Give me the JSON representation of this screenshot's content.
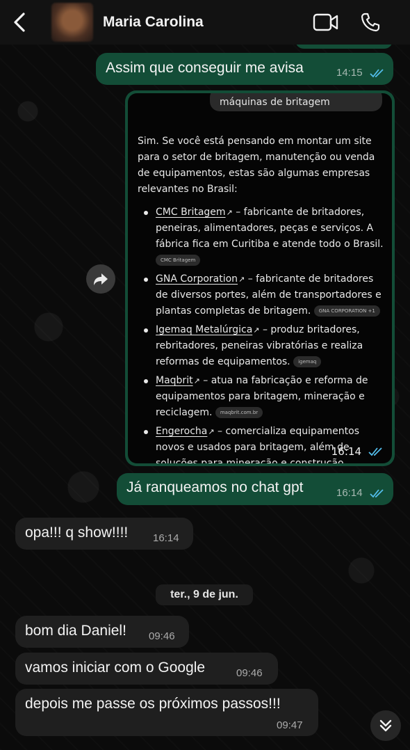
{
  "header": {
    "contact_name": "Maria Carolina",
    "icons": [
      "back-chevron-icon",
      "video-call-icon",
      "phone-call-icon"
    ]
  },
  "messages": [
    {
      "dir": "out",
      "text": "Assim que conseguir me avisa",
      "time": "14:15",
      "status": "read"
    },
    {
      "dir": "out",
      "type": "image",
      "time": "16:14",
      "status": "read"
    },
    {
      "dir": "out",
      "text": "Já ranqueamos no chat gpt",
      "time": "16:14",
      "status": "read"
    },
    {
      "dir": "in",
      "text": "opa!!! q show!!!!",
      "time": "16:14"
    },
    {
      "dir": "in",
      "text": "bom dia Daniel!",
      "time": "09:46"
    },
    {
      "dir": "in",
      "text": "vamos iniciar com o Google",
      "time": "09:46"
    },
    {
      "dir": "in",
      "text": "depois me passe os próximos passos!!!",
      "time": "09:47"
    }
  ],
  "date_divider": "ter., 9 de jun.",
  "screenshot": {
    "query": "máquinas de britagem",
    "intro": "Sim. Se você está pensando em montar um site para o setor de britagem, manutenção ou venda de equipamentos, estas são algumas empresas relevantes no Brasil:",
    "items": [
      {
        "name": "CMC Britagem",
        "desc": " – fabricante de britadores, peneiras, alimentadores, peças e serviços. A fábrica fica em Curitiba e atende todo o Brasil.",
        "source": "CMC Britagem"
      },
      {
        "name": "GNA Corporation",
        "desc": " – fabricante de britadores de diversos portes, além de transportadores e plantas completas de britagem.",
        "source": "GNA CORPORATION +1"
      },
      {
        "name": "Igemaq Metalúrgica",
        "desc": " – produz britadores, rebritadores, peneiras vibratórias e realiza reformas de equipamentos.",
        "source": "igemaq"
      },
      {
        "name": "Maqbrit",
        "desc": " – atua na fabricação e reforma de equipamentos para britagem, mineração e reciclagem.",
        "source": "maqbrit.com.br"
      },
      {
        "name": "Engerocha",
        "desc": " – comercializa equipamentos novos e usados para britagem, além de soluções para mineração e construção",
        "source": ""
      }
    ],
    "embedded_time": "16:14"
  },
  "colors": {
    "outgoing": "#134d37",
    "incoming": "#1f1f1f",
    "read_ticks": "#53bdeb"
  }
}
